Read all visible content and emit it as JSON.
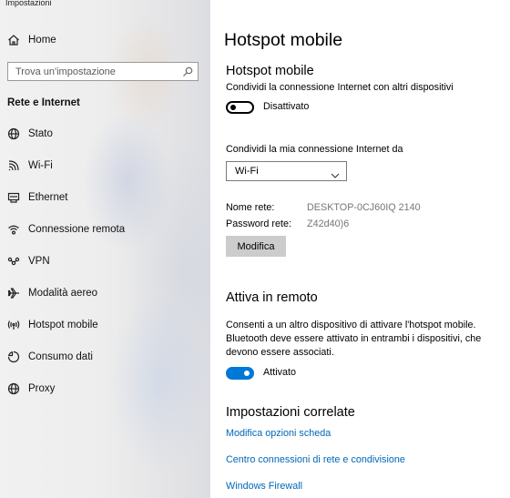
{
  "window": {
    "title": "Impostazioni"
  },
  "sidebar": {
    "home_label": "Home",
    "search_placeholder": "Trova un'impostazione",
    "section_title": "Rete e Internet",
    "items": [
      {
        "label": "Stato",
        "icon": "globe-status-icon"
      },
      {
        "label": "Wi-Fi",
        "icon": "wifi-icon"
      },
      {
        "label": "Ethernet",
        "icon": "ethernet-icon"
      },
      {
        "label": "Connessione remota",
        "icon": "dialup-icon"
      },
      {
        "label": "VPN",
        "icon": "vpn-icon"
      },
      {
        "label": "Modalità aereo",
        "icon": "airplane-icon"
      },
      {
        "label": "Hotspot mobile",
        "icon": "hotspot-icon"
      },
      {
        "label": "Consumo dati",
        "icon": "data-usage-icon"
      },
      {
        "label": "Proxy",
        "icon": "globe-proxy-icon"
      }
    ]
  },
  "main": {
    "page_title": "Hotspot mobile",
    "hotspot": {
      "heading": "Hotspot mobile",
      "description": "Condividi la connessione Internet con altri dispositivi",
      "toggle_state": "Disattivato",
      "toggle_on": false
    },
    "share_from": {
      "label": "Condividi la mia connessione Internet da",
      "selected": "Wi-Fi"
    },
    "network": {
      "name_label": "Nome rete:",
      "name_value": "DESKTOP-0CJ60IQ 2140",
      "password_label": "Password rete:",
      "password_value": "Z42d40)6",
      "edit_button": "Modifica"
    },
    "remote": {
      "heading": "Attiva in remoto",
      "description_lines": [
        "Consenti a un altro dispositivo di attivare l'hotspot mobile.",
        "Bluetooth deve essere attivato in entrambi i dispositivi, che",
        "devono essere associati."
      ],
      "toggle_state": "Attivato",
      "toggle_on": true
    },
    "related": {
      "heading": "Impostazioni correlate",
      "links": [
        "Modifica opzioni scheda",
        "Centro connessioni di rete e condivisione",
        "Windows Firewall"
      ]
    }
  },
  "colors": {
    "accent": "#0078d7",
    "link": "#0067b8",
    "secondary_text": "#767676",
    "button_bg": "#cccccc"
  }
}
